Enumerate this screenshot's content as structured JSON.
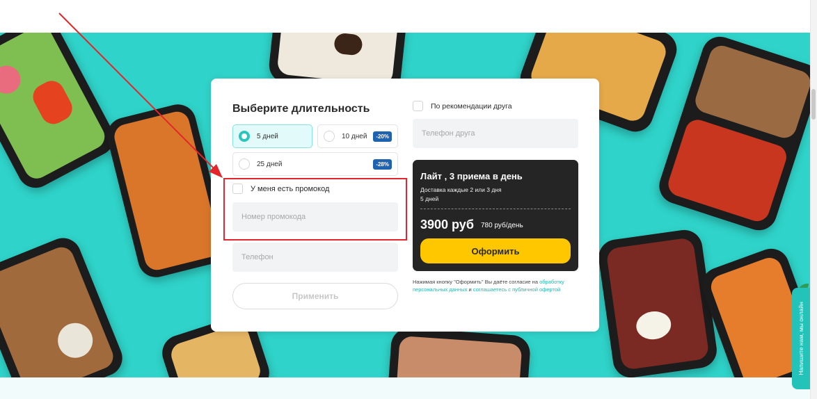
{
  "colors": {
    "hero_bg": "#2fd3c9",
    "accent_teal": "#2cc5bd",
    "discount_badge": "#1e62b0",
    "summary_bg": "#252525",
    "order_button": "#ffc700",
    "annotation_red": "#e3262b"
  },
  "form": {
    "title": "Выберите длительность",
    "durations": [
      {
        "label": "5 дней",
        "selected": true,
        "badge": ""
      },
      {
        "label": "10 дней",
        "selected": false,
        "badge": "-20%"
      },
      {
        "label": "25 дней",
        "selected": false,
        "badge": "-28%"
      }
    ],
    "promo_checkbox_label": "У меня есть промокод",
    "promo_placeholder": "Номер промокода",
    "phone_placeholder": "Телефон",
    "apply_label": "Применить",
    "friend_checkbox_label": "По рекомендации друга",
    "friend_phone_placeholder": "Телефон друга"
  },
  "summary": {
    "title": "Лайт , 3 приема в день",
    "delivery": "Доставка каждые 2 или 3 дня",
    "duration": "5 дней",
    "price": "3900 руб",
    "per_day": "780 руб/день",
    "order_label": "Оформить"
  },
  "consent": {
    "prefix": "Нажимая кнопку \"Оформить\" Вы даёте согласие на",
    "link1": "обработку персональных данных",
    "middle": "и",
    "link2": "соглашаетесь с публичной офертой"
  },
  "chat_tab": {
    "label": "Напишите нам, мы онлайн"
  },
  "icons": [
    "radio-selected-icon",
    "radio-icon",
    "checkbox-icon",
    "annotation-arrow-icon",
    "chat-leaf-icon"
  ]
}
